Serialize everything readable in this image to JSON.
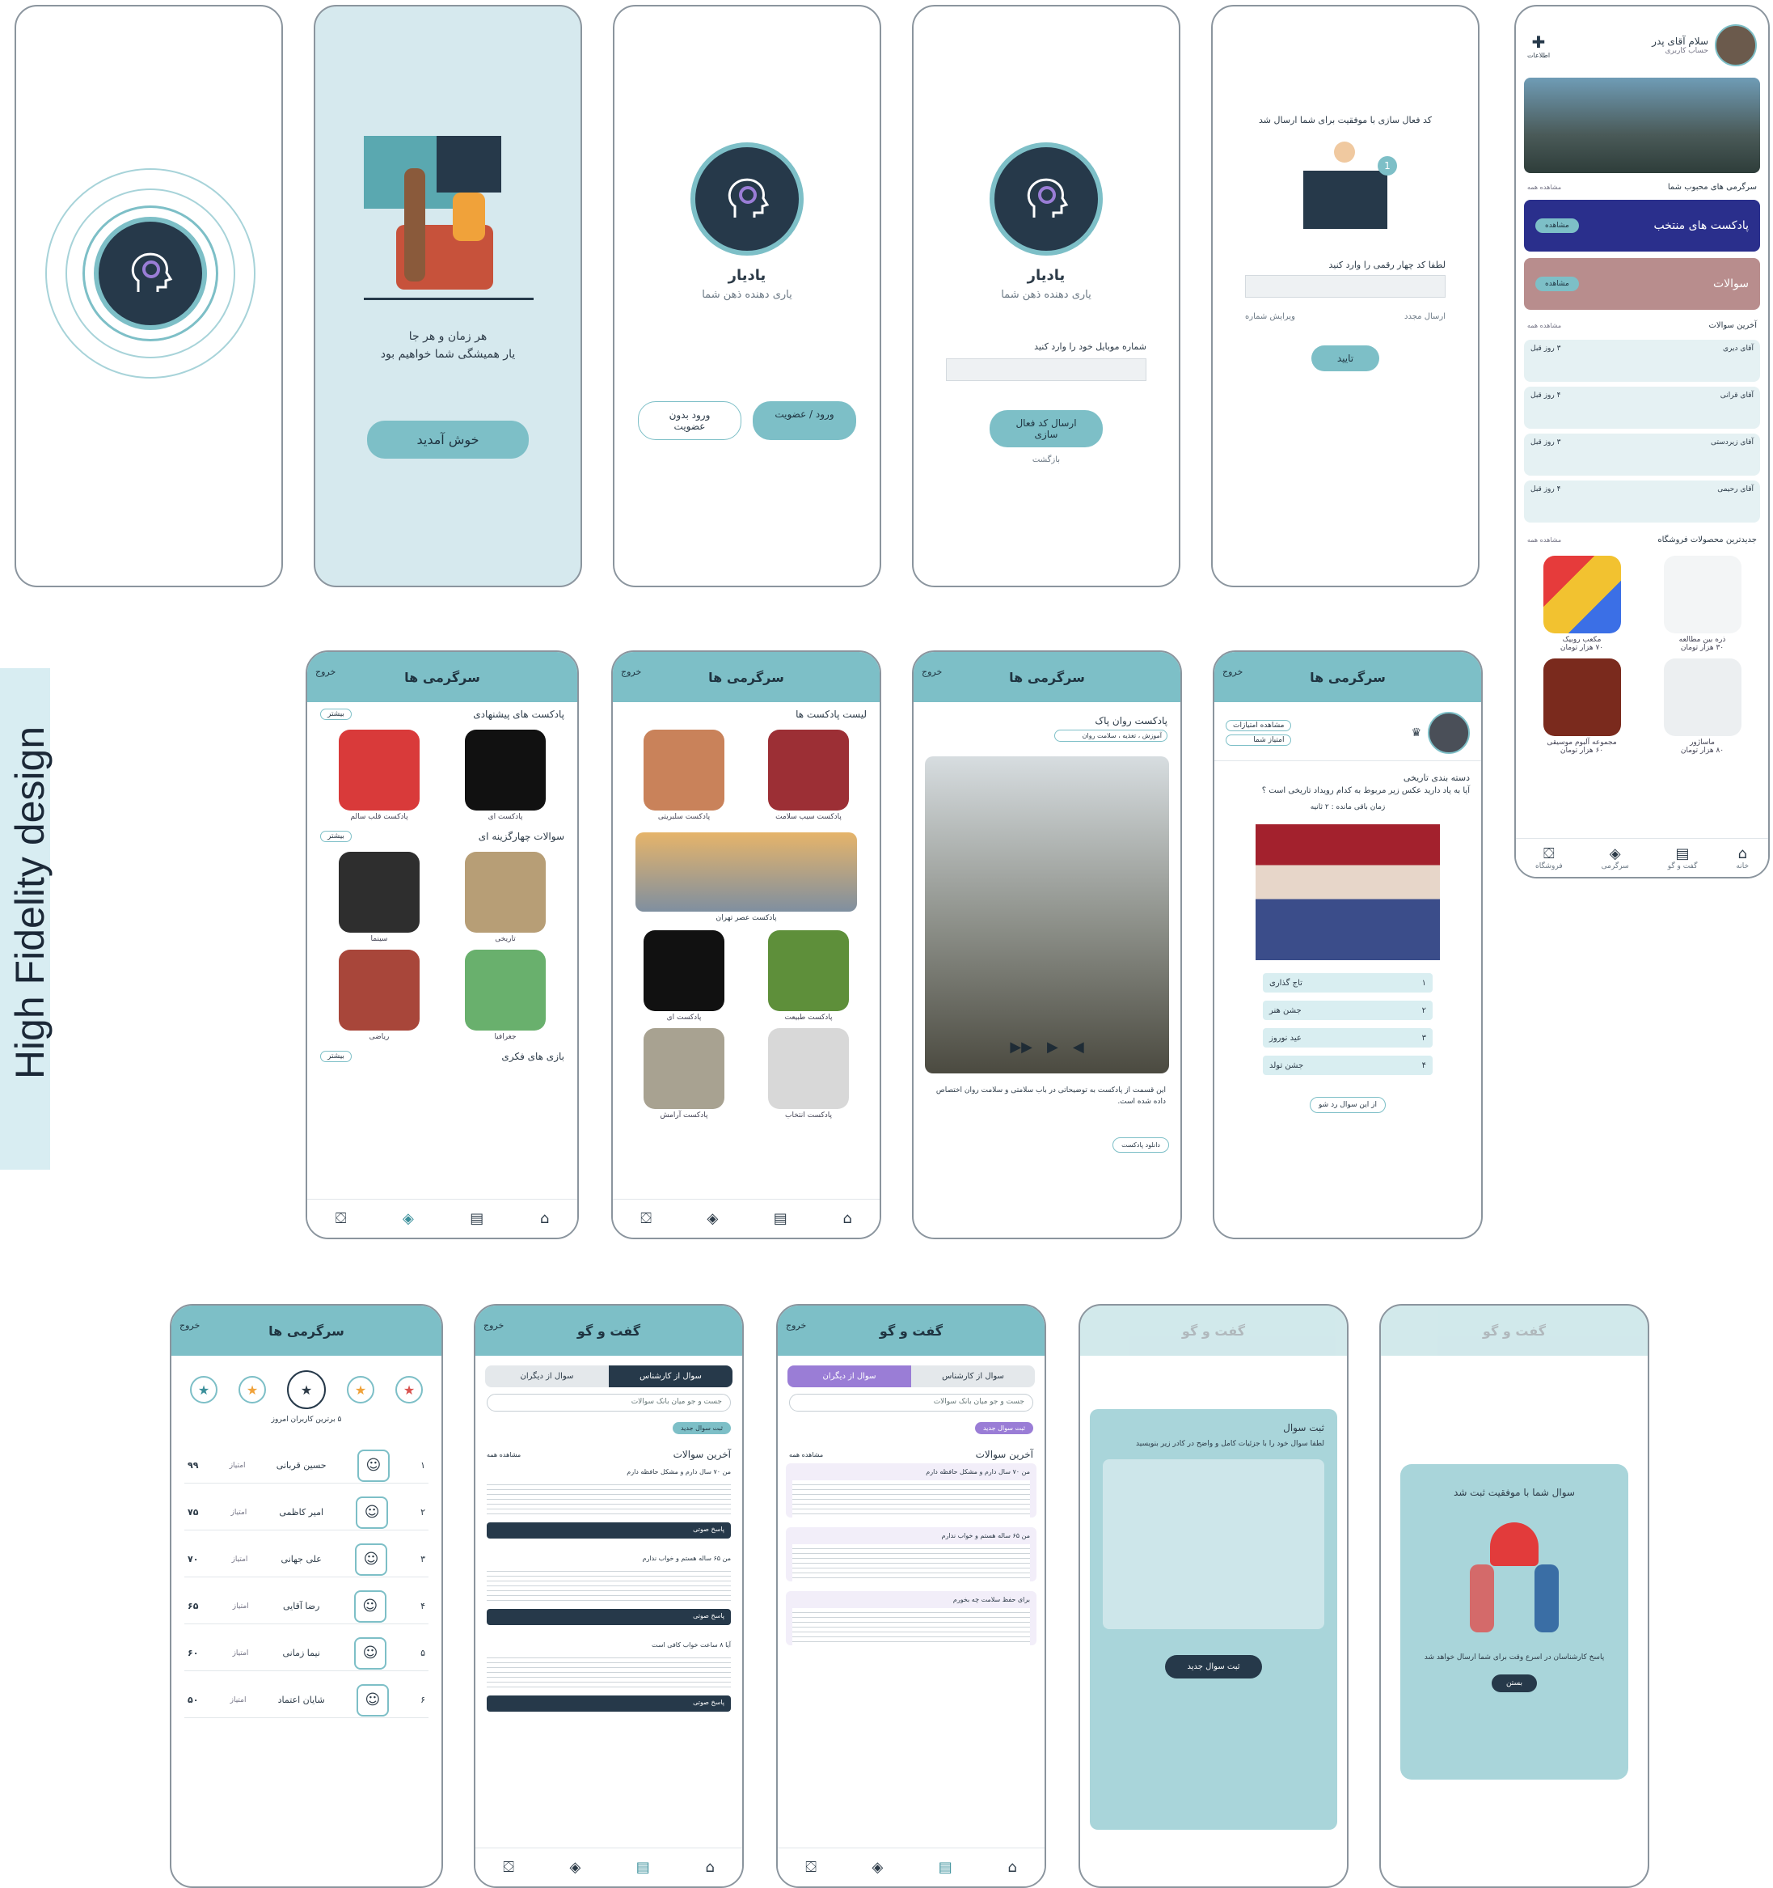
{
  "board_title": "High Fidelity design",
  "app": {
    "name": "یادیار",
    "tagline": "یاری دهنده ذهن شما"
  },
  "welcome": {
    "line1": "هر زمان و هر جا",
    "line2": "یار همیشگی شما خواهیم بود",
    "cta": "خوش آمدید"
  },
  "login": {
    "primary": "ورود / عضویت",
    "secondary": "ورود بدون عضویت"
  },
  "phone_entry": {
    "prompt": "شماره موبایل خود را وارد کنید",
    "submit": "ارسال کد فعال سازی",
    "back": "بازگشت"
  },
  "verify": {
    "message": "کد فعال سازی با موفقیت برای شما ارسال شد",
    "prompt": "لطفا کد چهار رقمی را وارد کنید",
    "resend": "ارسال مجدد",
    "edit": "ویرایش شماره",
    "confirm": "تایید"
  },
  "home": {
    "greeting": "سلام آقای پدر",
    "subtitle": "حساب کاربری",
    "badge": "اطلاعات",
    "fav_title": "سرگرمی های محبوب شما",
    "see_all": "مشاهده همه",
    "banner1": "پادکست های منتخب",
    "banner2": "سوالات",
    "banner_btn": "مشاهده",
    "questions_title": "آخرین سوالات",
    "shop_title": "جدیدترین محصولات فروشگاه",
    "questions": [
      {
        "user": "آقای دیری",
        "days": "۳ روز قبل"
      },
      {
        "user": "آقای قرانی",
        "days": "۴ روز قبل"
      },
      {
        "user": "آقای زیردستی",
        "days": "۳ روز قبل"
      },
      {
        "user": "آقای رحیمی",
        "days": "۴ روز قبل"
      }
    ],
    "products": [
      {
        "name": "ذره بین مطالعه",
        "price": "۳۰ هزار تومان"
      },
      {
        "name": "مکعب روبیک",
        "price": "۷۰ هزار تومان"
      },
      {
        "name": "ماساژور",
        "price": "۸۰ هزار تومان"
      },
      {
        "name": "مجموعه آلبوم موسیقی",
        "price": "۶۰ هزار تومان"
      }
    ]
  },
  "nav": {
    "home": "خانه",
    "chat": "گفت و گو",
    "games": "سرگرمی",
    "shop": "فروشگاه"
  },
  "header": {
    "entertain": "سرگرمی ها",
    "talk": "گفت و گو",
    "exit": "خروج"
  },
  "entertain": {
    "podcast_title": "پادکست های پیشنهادی",
    "more": "بیشتر",
    "podcasts": [
      "پادکست ای",
      "پادکست قلب سالم"
    ],
    "quiz_title": "سوالات چهارگزینه ای",
    "quizzes": [
      "تاریخی",
      "سینما",
      "جغرافیا",
      "ریاضی"
    ],
    "games_title": "بازی های فکری"
  },
  "podcast_list": {
    "title": "لیست پادکست ها",
    "items": [
      "پادکست سیب سلامت",
      "پادکست سلبریتی",
      "پادکست عصر تهران",
      "پادکست طبیعت",
      "پادکست ای",
      "پادکست انتخاب",
      "پادکست آرامش"
    ]
  },
  "player": {
    "title": "پادکست روان پاک",
    "tag": "آموزش ، تغذیه ، سلامت روان",
    "body": "این قسمت از پادکست به توضیحاتی در باب سلامتی و سلامت روان اختصاص داده شده است.",
    "download": "دانلود پادکست"
  },
  "quiz": {
    "category": "دسته بندی تاریخی",
    "question": "آیا به یاد دارید عکس زیر مربوط به کدام رویداد تاریخی است ؟",
    "timer": "زمان باقی مانده : ۲ ثانیه",
    "options": [
      "تاج گذاری",
      "جشن هنر",
      "عید نوروز",
      "جشن تولد"
    ],
    "skip": "از این سوال رد شو",
    "badge1": "مشاهده امتیازات",
    "badge2": "امتیاز شما"
  },
  "leaderboard": {
    "subtitle": "۵ برترین کاربران امروز",
    "rows": [
      {
        "rank": "۱",
        "name": "حسین قربانی",
        "score": "۹۹"
      },
      {
        "rank": "۲",
        "name": "امیر کاظمی",
        "score": "۷۵"
      },
      {
        "rank": "۳",
        "name": "علی جهانی",
        "score": "۷۰"
      },
      {
        "rank": "۴",
        "name": "رضا آقایی",
        "score": "۶۵"
      },
      {
        "rank": "۵",
        "name": "نیما زمانی",
        "score": "۶۰"
      },
      {
        "rank": "۶",
        "name": "شایان اعتماد",
        "score": "۵۰"
      }
    ],
    "score_label": "امتیاز"
  },
  "talk": {
    "tab_a": "سوال از کارشناس",
    "tab_b": "سوال از دیگران",
    "search": "جست و جو میان بانک سوالات",
    "add": "ثبت سوال جدید",
    "latest": "آخرین سوالات",
    "all": "مشاهده همه",
    "listen": "پاسخ صوتی",
    "posts": [
      "من ۷۰ سال دارم و مشکل حافظه دارم",
      "من ۶۵ ساله هستم و خواب ندارم",
      "آیا ۸ ساعت خواب کافی است",
      "برای حفظ سلامت چه بخورم"
    ]
  },
  "new_question": {
    "title": "ثبت سوال",
    "hint": "لطفا سوال خود را با جزئیات کامل و واضح در کادر زیر بنویسید",
    "submit": "ثبت سوال جدید"
  },
  "success": {
    "title": "سوال شما با موفقیت ثبت شد",
    "note": "پاسخ کارشناسان در اسرع وقت برای شما ارسال خواهد شد",
    "ok": "بستن"
  },
  "colors": {
    "teal": "#7dbfc7",
    "navy": "#26394a",
    "purple": "#9a7dd6"
  }
}
